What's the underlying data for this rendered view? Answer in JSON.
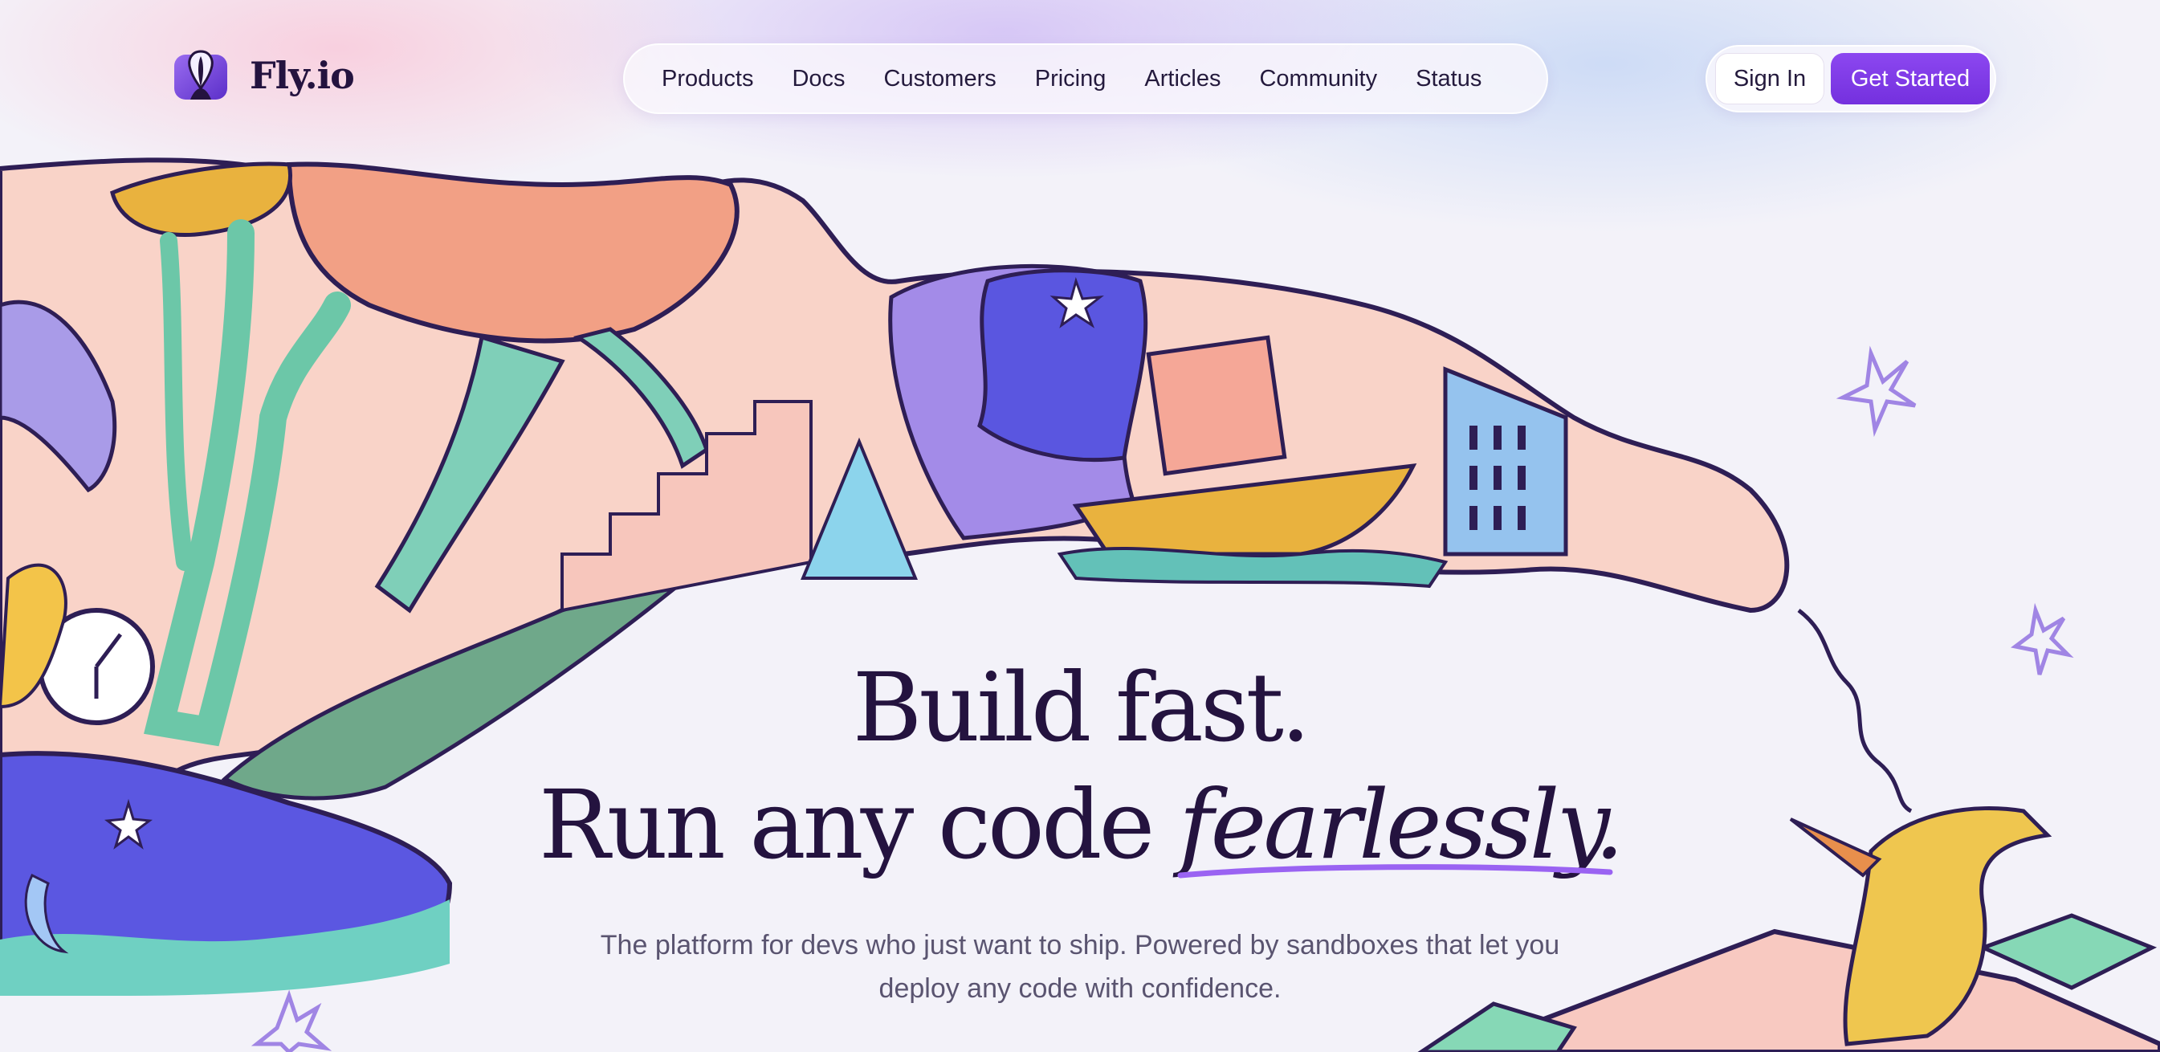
{
  "brand": {
    "name": "Fly.io",
    "logo_icon": "balloon-logo-icon"
  },
  "nav": {
    "items": [
      {
        "label": "Products"
      },
      {
        "label": "Docs"
      },
      {
        "label": "Customers"
      },
      {
        "label": "Pricing"
      },
      {
        "label": "Articles"
      },
      {
        "label": "Community"
      },
      {
        "label": "Status"
      }
    ]
  },
  "auth": {
    "sign_in": "Sign In",
    "get_started": "Get Started"
  },
  "hero": {
    "line1": "Build fast.",
    "line2_prefix": "Run any code ",
    "line2_emphasis": "fearlessly.",
    "subtitle": "The platform for devs who just want to ship. Powered by sandboxes that let you deploy any code with confidence."
  },
  "colors": {
    "accent": "#7b37e6",
    "heading": "#24133f",
    "body_text": "#5a5470",
    "background": "#f3f2f9"
  }
}
